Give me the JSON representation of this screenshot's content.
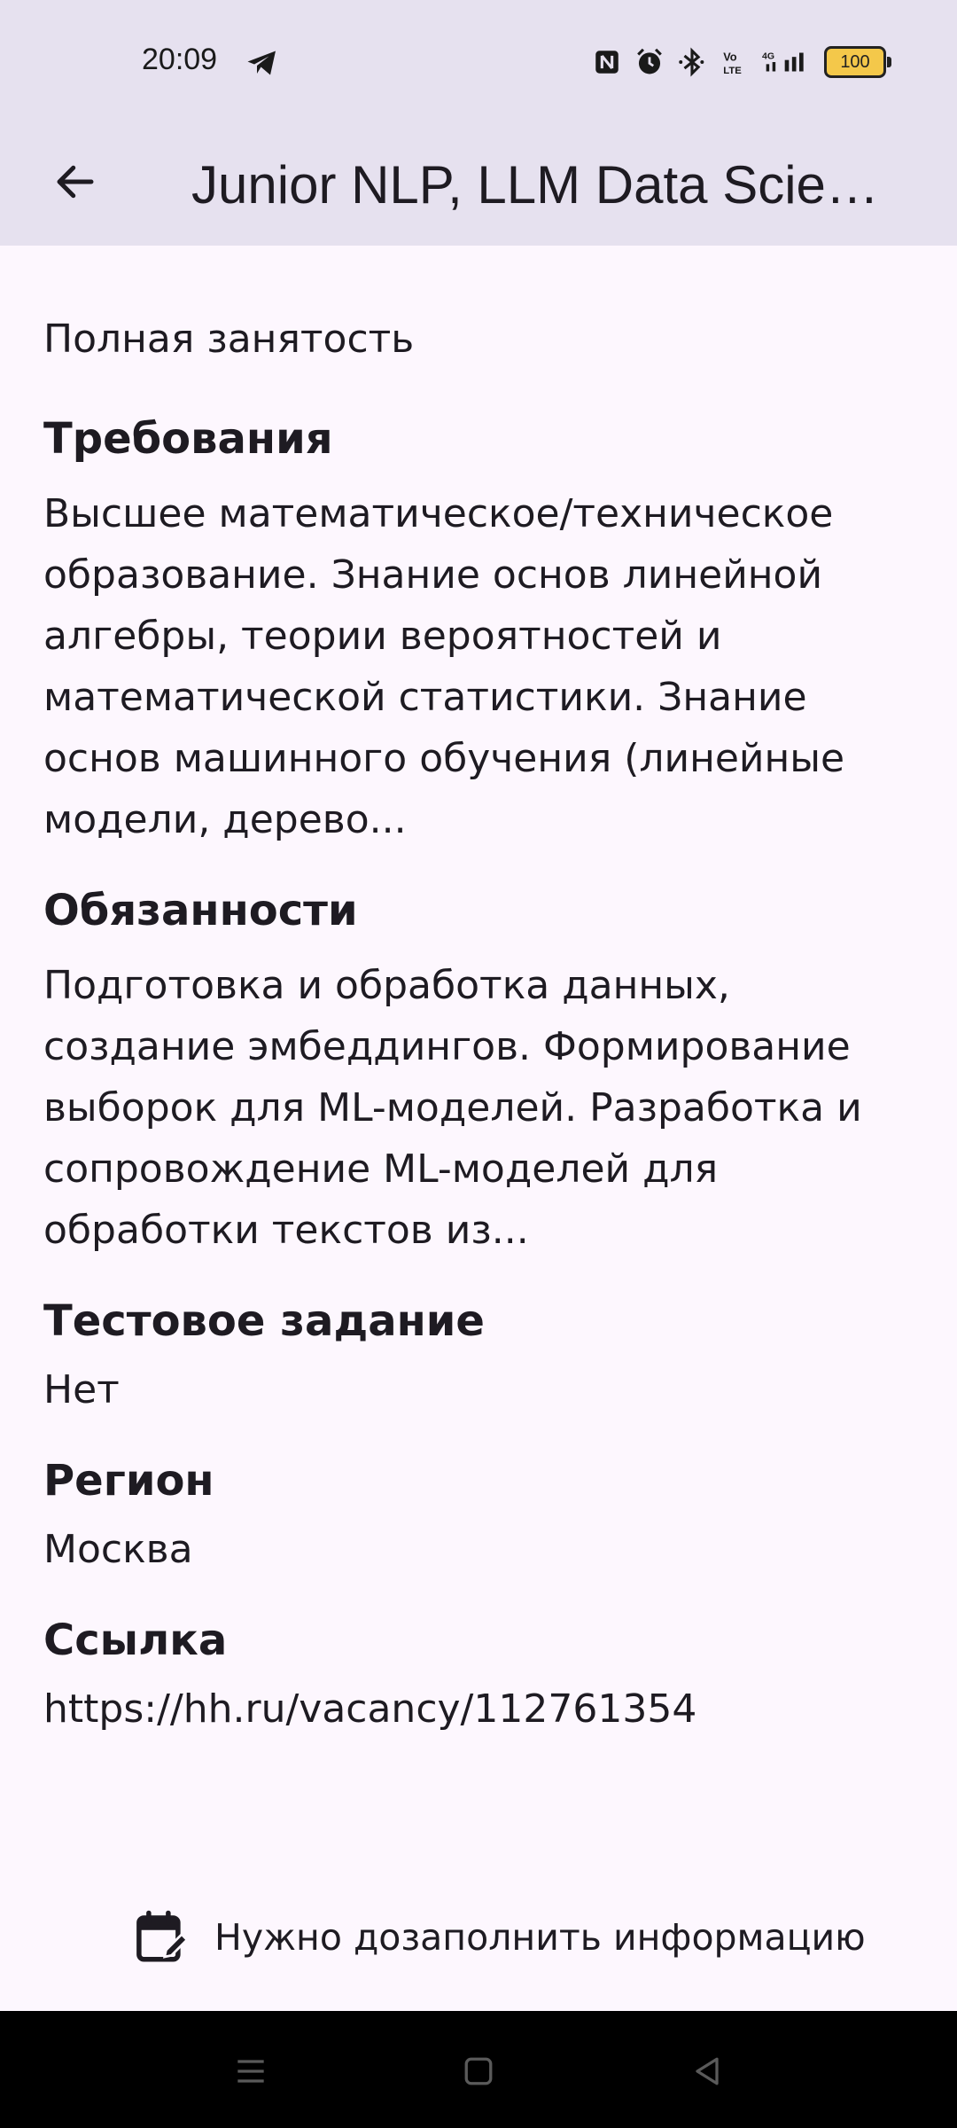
{
  "status_bar": {
    "time": "20:09",
    "battery": "100",
    "icons": [
      "telegram-icon",
      "nfc-icon",
      "alarm-icon",
      "bluetooth-icon",
      "volte-icon",
      "signal-4g-icon",
      "battery-icon"
    ]
  },
  "app_bar": {
    "title": "Junior NLP, LLM Data Scie…"
  },
  "vacancy": {
    "employment": "Полная занятость",
    "requirements": {
      "title": "Требования",
      "text": "Высшее математическое/техническое\nобразование. Знание основ линейной\nалгебры, теории вероятностей и\nматематической статистики. Знание\nоснов машинного обучения (линейные\nмодели, дерево..."
    },
    "duties": {
      "title": "Обязанности",
      "text": "Подготовка и обработка данных,\nсоздание эмбеддингов. Формирование\nвыборок для ML-моделей. Разработка и\nсопровождение ML-моделей для\nобработки текстов из..."
    },
    "test_task": {
      "title": "Тестовое задание",
      "text": "Нет"
    },
    "region": {
      "title": "Регион",
      "text": "Москва"
    },
    "link": {
      "title": "Ссылка",
      "text": "https://hh.ru/vacancy/112761354"
    }
  },
  "action": {
    "fill_info_label": "Нужно дозаполнить информацию"
  },
  "colors": {
    "app_bar_bg": "#e6e1ef",
    "page_bg": "#fdf7fe",
    "text": "#1e1b22"
  }
}
